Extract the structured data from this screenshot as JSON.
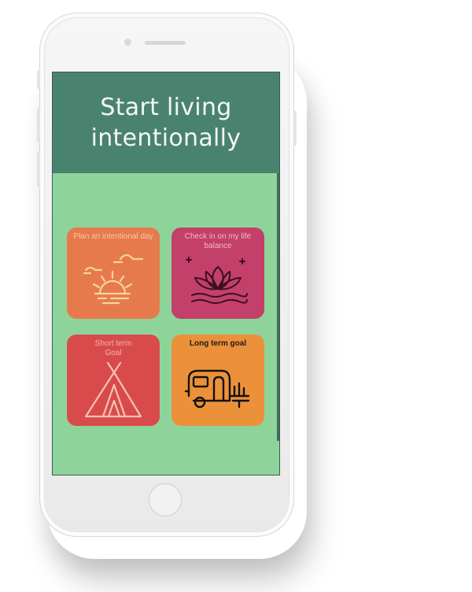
{
  "app": {
    "hero_title_line1": "Start living",
    "hero_title_line2": "intentionally"
  },
  "tiles": [
    {
      "label": "Plan an intentional day",
      "icon": "sunrise-icon",
      "color": "#e77a4d"
    },
    {
      "label": "Check in on my life balance",
      "icon": "lotus-icon",
      "color": "#c3406a"
    },
    {
      "label": "Short term Goal",
      "icon": "tent-icon",
      "color": "#d94b4a"
    },
    {
      "label": "Long term goal",
      "icon": "camper-trailer-icon",
      "color": "#ec9139"
    }
  ],
  "colors": {
    "screen_bg": "#8ed49a",
    "hero_bg": "#4a8270"
  }
}
